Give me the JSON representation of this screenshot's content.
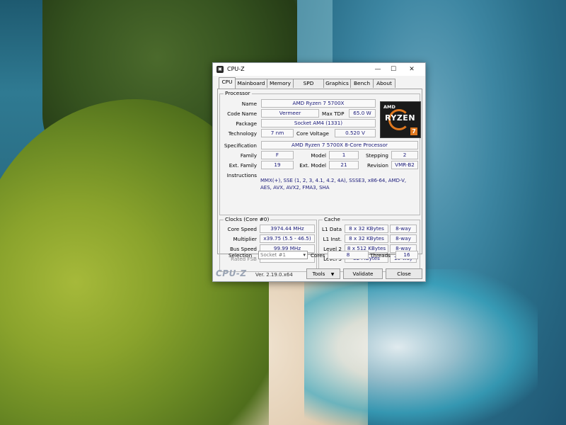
{
  "window": {
    "title": "CPU-Z",
    "icon": "cpuz-app-icon",
    "controls": {
      "minimize": "—",
      "maximize": "☐",
      "close": "✕"
    }
  },
  "tabs": [
    {
      "label": "CPU",
      "active": true
    },
    {
      "label": "Mainboard"
    },
    {
      "label": "Memory"
    },
    {
      "label": "SPD"
    },
    {
      "label": "Graphics"
    },
    {
      "label": "Bench"
    },
    {
      "label": "About"
    }
  ],
  "processor": {
    "group_title": "Processor",
    "labels": {
      "name": "Name",
      "code_name": "Code Name",
      "max_tdp": "Max TDP",
      "package": "Package",
      "technology": "Technology",
      "core_voltage": "Core Voltage",
      "specification": "Specification",
      "family": "Family",
      "model": "Model",
      "stepping": "Stepping",
      "ext_family": "Ext. Family",
      "ext_model": "Ext. Model",
      "revision": "Revision",
      "instructions": "Instructions"
    },
    "values": {
      "name": "AMD Ryzen 7 5700X",
      "code_name": "Vermeer",
      "max_tdp": "65.0 W",
      "package": "Socket AM4 (1331)",
      "technology": "7 nm",
      "core_voltage": "0.520 V",
      "specification": "AMD Ryzen 7 5700X 8-Core Processor",
      "family": "F",
      "model": "1",
      "stepping": "2",
      "ext_family": "19",
      "ext_model": "21",
      "revision": "VMR-B2",
      "instructions": "MMX(+), SSE (1, 2, 3, 4.1, 4.2, 4A), SSSE3, x86-64, AMD-V, AES, AVX, AVX2, FMA3, SHA"
    },
    "logo": {
      "brand": "AMD",
      "product": "RYZEN",
      "tier": "7"
    }
  },
  "clocks": {
    "group_title": "Clocks (Core #0)",
    "labels": {
      "core_speed": "Core Speed",
      "multiplier": "Multiplier",
      "bus_speed": "Bus Speed",
      "rated_fsb": "Rated FSB"
    },
    "values": {
      "core_speed": "3974.44 MHz",
      "multiplier": "x39.75 (5.5 - 46.5)",
      "bus_speed": "99.99 MHz",
      "rated_fsb": ""
    }
  },
  "cache": {
    "group_title": "Cache",
    "rows": [
      {
        "label": "L1 Data",
        "size": "8 x 32 KBytes",
        "ways": "8-way"
      },
      {
        "label": "L1 Inst.",
        "size": "8 x 32 KBytes",
        "ways": "8-way"
      },
      {
        "label": "Level 2",
        "size": "8 x 512 KBytes",
        "ways": "8-way"
      },
      {
        "label": "Level 3",
        "size": "32 MBytes",
        "ways": "16-way"
      }
    ]
  },
  "selection": {
    "label": "Selection",
    "selected": "Socket #1",
    "cores_label": "Cores",
    "cores": "8",
    "threads_label": "Threads",
    "threads": "16"
  },
  "footer": {
    "brand": "CPU-Z",
    "version": "Ver. 2.19.0.x64",
    "tools": "Tools",
    "validate": "Validate",
    "close": "Close"
  }
}
